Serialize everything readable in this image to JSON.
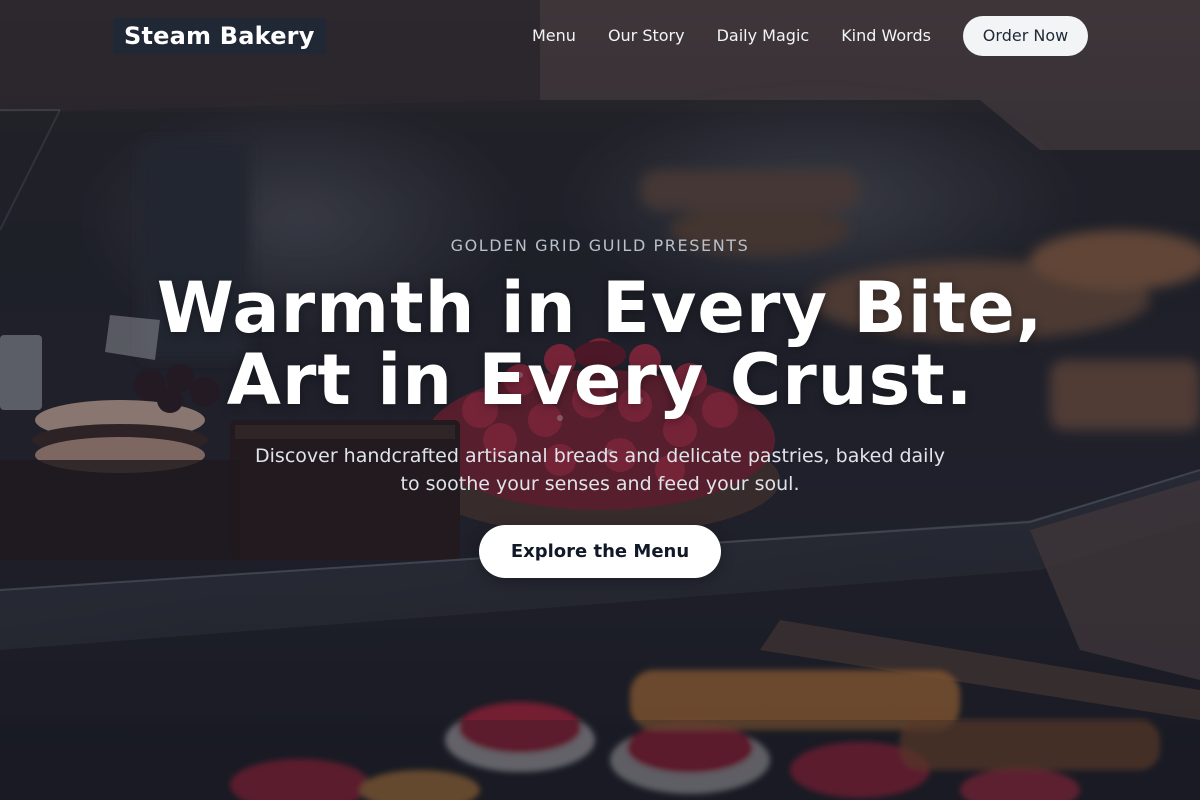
{
  "header": {
    "brand": "Steam Bakery",
    "nav": [
      {
        "label": "Menu"
      },
      {
        "label": "Our Story"
      },
      {
        "label": "Daily Magic"
      },
      {
        "label": "Kind Words"
      }
    ],
    "cta_label": "Order Now"
  },
  "hero": {
    "eyebrow": "GOLDEN GRID GUILD PRESENTS",
    "headline_line1": "Warmth in Every Bite,",
    "headline_line2": "Art in Every Crust.",
    "subtext": "Discover handcrafted artisanal breads and delicate pastries, baked daily to soothe your senses and feed your soul.",
    "cta_label": "Explore the Menu",
    "background_image": "bakery-display-case-pastries"
  },
  "colors": {
    "overlay": "#141822",
    "brand_bg": "#1f2937",
    "button_bg": "#ffffff",
    "button_text": "#111827"
  }
}
